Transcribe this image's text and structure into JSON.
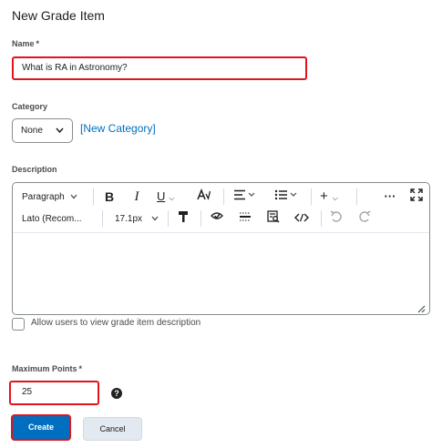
{
  "page": {
    "title": "New Grade Item"
  },
  "name_field": {
    "label": "Name",
    "required_marker": "*",
    "value": "What is RA in Astronomy?"
  },
  "category": {
    "label": "Category",
    "selected": "None",
    "new_link": "[New Category]"
  },
  "description": {
    "label": "Description",
    "toolbar": {
      "paragraph_style": "Paragraph",
      "font_family": "Lato (Recom...",
      "font_size": "17.1px",
      "icons": [
        "bold-icon",
        "italic-icon",
        "underline-icon",
        "text-format-icon",
        "align-icon",
        "list-icon",
        "insert-icon",
        "more-icon",
        "fullscreen-icon",
        "format-painter-icon",
        "accessibility-checker-icon",
        "horizontal-rule-icon",
        "preview-icon",
        "source-code-icon",
        "undo-icon",
        "redo-icon"
      ]
    }
  },
  "allow_description": {
    "label": "Allow users to view grade item description",
    "checked": false
  },
  "max_points": {
    "label": "Maximum Points",
    "required_marker": "*",
    "value": "25"
  },
  "buttons": {
    "create": "Create",
    "cancel": "Cancel"
  },
  "colors": {
    "primary": "#006fbf",
    "highlight": "#e0141e",
    "link": "#006fbf"
  }
}
